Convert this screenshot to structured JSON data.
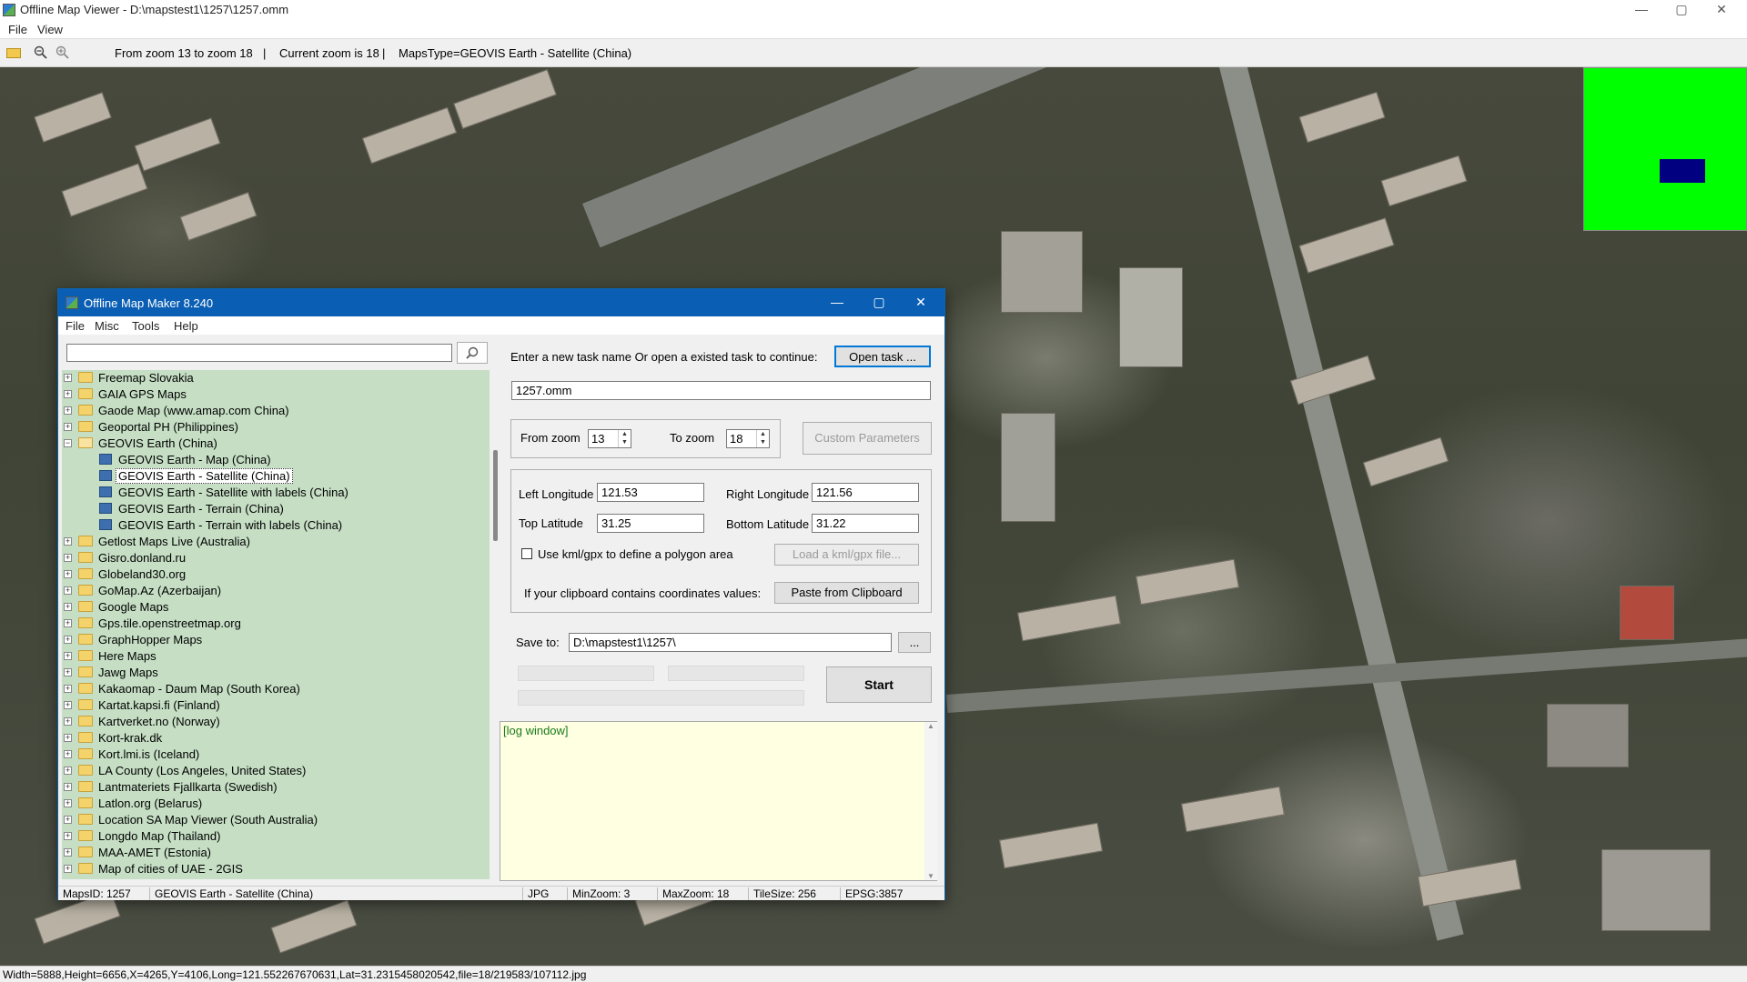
{
  "window": {
    "title": "Offline Map Viewer - D:\\mapstest1\\1257\\1257.omm",
    "menu": [
      "File",
      "View"
    ],
    "controls": {
      "minimize": "—",
      "maximize": "▢",
      "close": "✕"
    }
  },
  "toolbar": {
    "icons": [
      "open-folder-icon",
      "zoom-out-icon",
      "zoom-in-icon"
    ],
    "zoom_range": "From zoom 13 to zoom 18",
    "sep1": "|",
    "current_zoom": "Current zoom is 18",
    "sep2": "|",
    "maps_type": "MapsType=GEOVIS Earth - Satellite (China)"
  },
  "overview": {
    "bg_color": "#00ff00",
    "viewport_color": "#000080"
  },
  "status_bar": "Width=5888,Height=6656,X=4265,Y=4106,Long=121.552267670631,Lat=31.2315458020542,file=18/219583/107112.jpg",
  "dialog": {
    "title": "Offline Map Maker 8.240",
    "menu": [
      "File",
      "Misc",
      "Tools",
      "Help"
    ],
    "search": {
      "value": "",
      "icon": "search-icon"
    },
    "tree": [
      {
        "label": "Freemap Slovakia",
        "type": "folder"
      },
      {
        "label": "GAIA GPS Maps",
        "type": "folder"
      },
      {
        "label": "Gaode Map (www.amap.com China)",
        "type": "folder"
      },
      {
        "label": "Geoportal PH (Philippines)",
        "type": "folder"
      },
      {
        "label": "GEOVIS Earth (China)",
        "type": "folder-open"
      },
      {
        "label": "GEOVIS Earth - Map (China)",
        "type": "map"
      },
      {
        "label": "GEOVIS Earth - Satellite (China)",
        "type": "map",
        "selected": true
      },
      {
        "label": "GEOVIS Earth - Satellite with labels (China)",
        "type": "map"
      },
      {
        "label": "GEOVIS Earth - Terrain (China)",
        "type": "map"
      },
      {
        "label": "GEOVIS Earth - Terrain with labels (China)",
        "type": "map"
      },
      {
        "label": "Getlost Maps Live (Australia)",
        "type": "folder"
      },
      {
        "label": "Gisro.donland.ru",
        "type": "folder"
      },
      {
        "label": "Globeland30.org",
        "type": "folder"
      },
      {
        "label": "GoMap.Az (Azerbaijan)",
        "type": "folder"
      },
      {
        "label": "Google Maps",
        "type": "folder"
      },
      {
        "label": "Gps.tile.openstreetmap.org",
        "type": "folder"
      },
      {
        "label": "GraphHopper Maps",
        "type": "folder"
      },
      {
        "label": "Here Maps",
        "type": "folder"
      },
      {
        "label": "Jawg Maps",
        "type": "folder"
      },
      {
        "label": "Kakaomap - Daum Map (South Korea)",
        "type": "folder"
      },
      {
        "label": "Kartat.kapsi.fi (Finland)",
        "type": "folder"
      },
      {
        "label": "Kartverket.no (Norway)",
        "type": "folder"
      },
      {
        "label": "Kort-krak.dk",
        "type": "folder"
      },
      {
        "label": "Kort.lmi.is (Iceland)",
        "type": "folder"
      },
      {
        "label": "LA County (Los Angeles, United States)",
        "type": "folder"
      },
      {
        "label": "Lantmateriets Fjallkarta (Swedish)",
        "type": "folder"
      },
      {
        "label": "Latlon.org (Belarus)",
        "type": "folder"
      },
      {
        "label": "Location SA Map Viewer (South Australia)",
        "type": "folder"
      },
      {
        "label": "Longdo Map (Thailand)",
        "type": "folder"
      },
      {
        "label": "MAA-AMET (Estonia)",
        "type": "folder"
      },
      {
        "label": "Map of cities of UAE - 2GIS",
        "type": "folder"
      }
    ],
    "task_prompt": "Enter a new task name Or open a existed task to continue:",
    "open_task_btn": "Open task ...",
    "task_name": "1257.omm",
    "from_zoom_label": "From zoom",
    "from_zoom": "13",
    "to_zoom_label": "To zoom",
    "to_zoom": "18",
    "custom_params_btn": "Custom Parameters",
    "left_lon_label": "Left Longitude",
    "left_lon": "121.53",
    "right_lon_label": "Right Longitude",
    "right_lon": "121.56",
    "top_lat_label": "Top Latitude",
    "top_lat": "31.25",
    "bottom_lat_label": "Bottom Latitude",
    "bottom_lat": "31.22",
    "kml_label": "Use kml/gpx to define a polygon area",
    "kml_checked": false,
    "load_kml_btn": "Load a kml/gpx file...",
    "clipboard_label": "If your clipboard contains coordinates values:",
    "paste_btn": "Paste from Clipboard",
    "save_to_label": "Save to:",
    "save_to": "D:\\mapstest1\\1257\\",
    "browse_btn": "...",
    "start_btn": "Start",
    "progress": [
      0,
      0,
      0
    ],
    "log_text": "[log window]",
    "status": {
      "maps_id": "MapsID: 1257",
      "map_name": "GEOVIS Earth - Satellite (China)",
      "format": "JPG",
      "min_zoom": "MinZoom: 3",
      "max_zoom": "MaxZoom: 18",
      "tile_size": "TileSize: 256",
      "epsg": "EPSG:3857"
    }
  }
}
